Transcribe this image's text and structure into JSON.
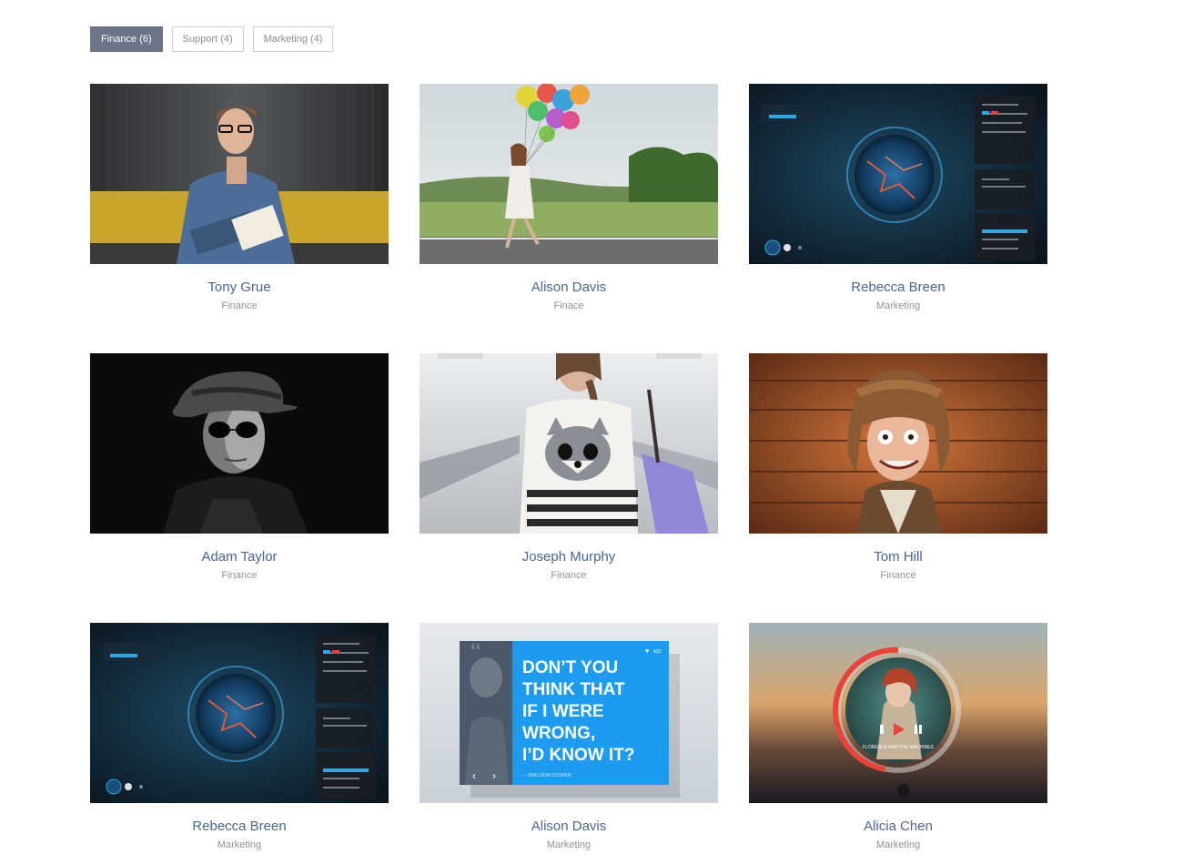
{
  "filters": [
    {
      "label": "Finance (6)",
      "active": true
    },
    {
      "label": "Support (4)",
      "active": false
    },
    {
      "label": "Marketing (4)",
      "active": false
    }
  ],
  "cards": [
    {
      "name": "Tony Grue",
      "dept": "Finance"
    },
    {
      "name": "Alison Davis",
      "dept": "Finace"
    },
    {
      "name": "Rebecca Breen",
      "dept": "Marketing"
    },
    {
      "name": "Adam Taylor",
      "dept": "Finance"
    },
    {
      "name": "Joseph Murphy",
      "dept": "Finance"
    },
    {
      "name": "Tom Hill",
      "dept": "Finance"
    },
    {
      "name": "Rebecca Breen",
      "dept": "Marketing"
    },
    {
      "name": "Alison Davis",
      "dept": "Marketing"
    },
    {
      "name": "Alicia Chen",
      "dept": "Marketing"
    }
  ],
  "quote_card": {
    "text_lines": [
      "DON’T YOU",
      "THINK THAT",
      "IF I WERE",
      "WRONG,",
      "I’D KNOW IT?"
    ],
    "author": "— SHELDON COOPER",
    "likes": "422"
  },
  "music_card": {
    "song": "FLORENCE AND THE MACHINES"
  },
  "colors": {
    "accent": "#6b7587",
    "name_text": "#4a6591",
    "dept_text": "#8e939b",
    "quote_blue": "#1d9bf0"
  }
}
